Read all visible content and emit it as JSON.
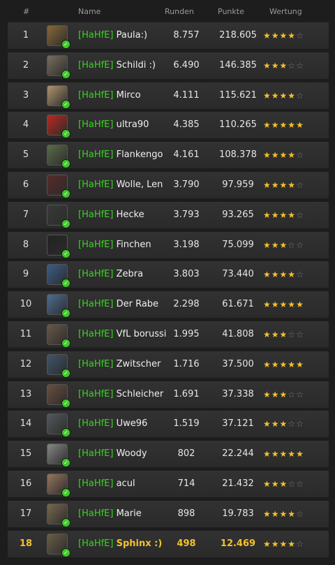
{
  "header": {
    "rank": "#",
    "name": "Name",
    "rounds": "Runden",
    "points": "Punkte",
    "rating": "Wertung"
  },
  "colors": {
    "tag": "#39d322",
    "star": "#f6c12c",
    "highlight": "#f6c12c",
    "online": "#3ecb27"
  },
  "rows": [
    {
      "rank": "1",
      "tag": "[HaHfE]",
      "nick": "Paula:)",
      "rounds": "8.757",
      "points": "218.605",
      "stars": 4,
      "avatar": "#8a6a3a"
    },
    {
      "rank": "2",
      "tag": "[HaHfE]",
      "nick": "Schildi :)",
      "rounds": "6.490",
      "points": "146.385",
      "stars": 3,
      "avatar": "#7a7060"
    },
    {
      "rank": "3",
      "tag": "[HaHfE]",
      "nick": "Mirco",
      "rounds": "4.111",
      "points": "115.621",
      "stars": 4,
      "avatar": "#b39a72"
    },
    {
      "rank": "4",
      "tag": "[HaHfE]",
      "nick": "ultra90",
      "rounds": "4.385",
      "points": "110.265",
      "stars": 5,
      "avatar": "#c0281e"
    },
    {
      "rank": "5",
      "tag": "[HaHfE]",
      "nick": "Flankengo",
      "rounds": "4.161",
      "points": "108.378",
      "stars": 4,
      "avatar": "#5b6e4a"
    },
    {
      "rank": "6",
      "tag": "[HaHfE]",
      "nick": "Wolle, Len",
      "rounds": "3.790",
      "points": "97.959",
      "stars": 4,
      "avatar": "#5a2a2a"
    },
    {
      "rank": "7",
      "tag": "[HaHfE]",
      "nick": "Hecke",
      "rounds": "3.793",
      "points": "93.265",
      "stars": 4,
      "avatar": "#3a3a3a"
    },
    {
      "rank": "8",
      "tag": "[HaHfE]",
      "nick": "Finchen",
      "rounds": "3.198",
      "points": "75.099",
      "stars": 3,
      "avatar": "#222222"
    },
    {
      "rank": "9",
      "tag": "[HaHfE]",
      "nick": "Zebra",
      "rounds": "3.803",
      "points": "73.440",
      "stars": 4,
      "avatar": "#3b5f8a"
    },
    {
      "rank": "10",
      "tag": "[HaHfE]",
      "nick": "Der Rabe",
      "rounds": "2.298",
      "points": "61.671",
      "stars": 5,
      "avatar": "#4e6f95"
    },
    {
      "rank": "11",
      "tag": "[HaHfE]",
      "nick": "VfL borussi",
      "rounds": "1.995",
      "points": "41.808",
      "stars": 3,
      "avatar": "#6a5a48"
    },
    {
      "rank": "12",
      "tag": "[HaHfE]",
      "nick": "Zwitscher",
      "rounds": "1.716",
      "points": "37.500",
      "stars": 5,
      "avatar": "#41576e"
    },
    {
      "rank": "13",
      "tag": "[HaHfE]",
      "nick": "Schleicher",
      "rounds": "1.691",
      "points": "37.338",
      "stars": 3,
      "avatar": "#6b5040"
    },
    {
      "rank": "14",
      "tag": "[HaHfE]",
      "nick": "Uwe96",
      "rounds": "1.519",
      "points": "37.121",
      "stars": 3,
      "avatar": "#555a5e"
    },
    {
      "rank": "15",
      "tag": "[HaHfE]",
      "nick": "Woody",
      "rounds": "802",
      "points": "22.244",
      "stars": 5,
      "avatar": "#8a8a8a"
    },
    {
      "rank": "16",
      "tag": "[HaHfE]",
      "nick": "acul",
      "rounds": "714",
      "points": "21.432",
      "stars": 3,
      "avatar": "#9a7860"
    },
    {
      "rank": "17",
      "tag": "[HaHfE]",
      "nick": "Marie",
      "rounds": "898",
      "points": "19.783",
      "stars": 4,
      "avatar": "#7a6a50"
    },
    {
      "rank": "18",
      "tag": "[HaHfE]",
      "nick": "Sphinx :)",
      "rounds": "498",
      "points": "12.469",
      "stars": 4,
      "avatar": "#6a6048",
      "current_user": true
    }
  ]
}
